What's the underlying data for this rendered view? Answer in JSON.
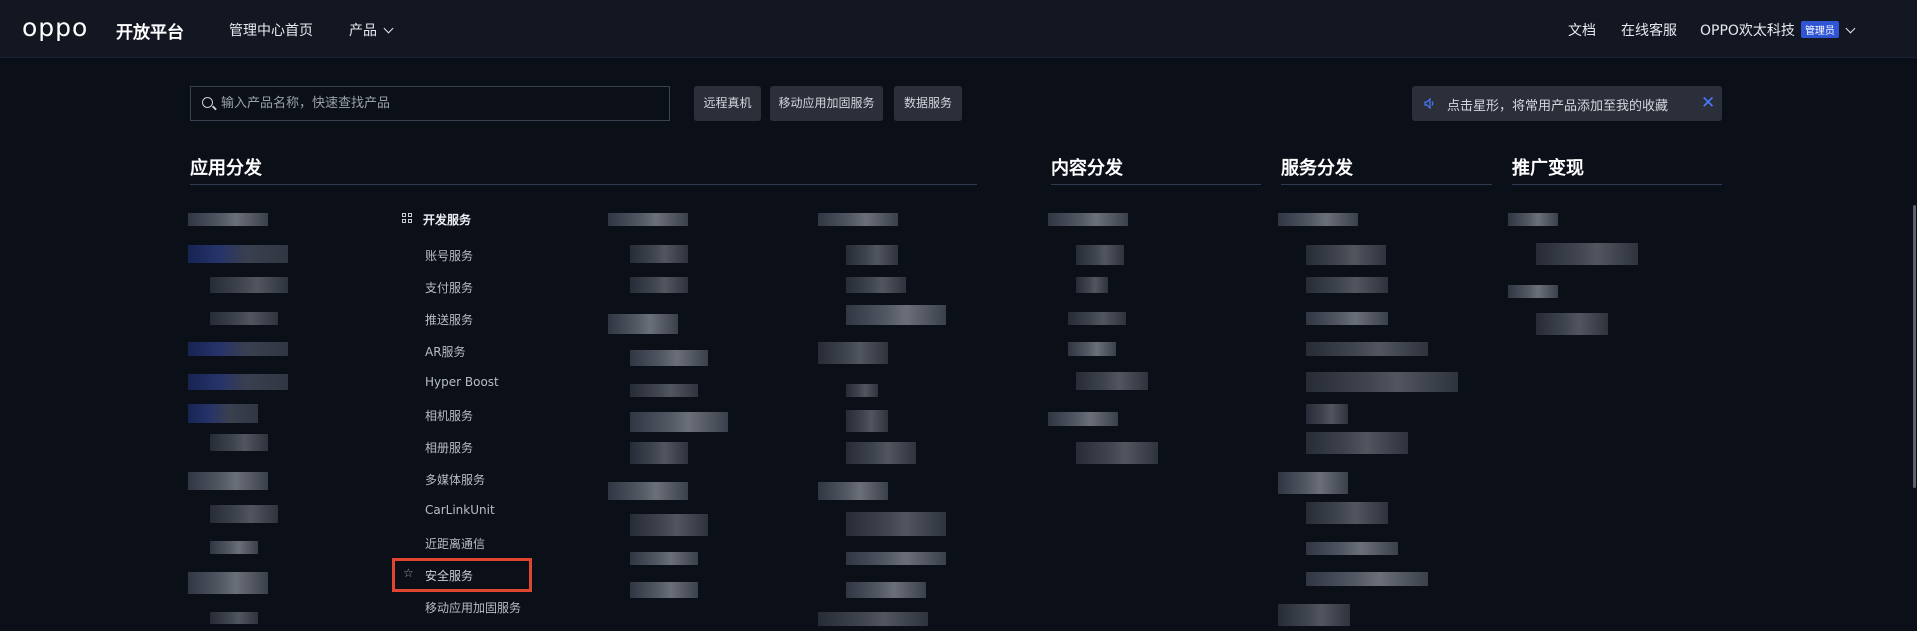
{
  "header": {
    "logo": "oppo",
    "platform": "开放平台",
    "nav_home": "管理中心首页",
    "nav_product": "产品",
    "nav_docs": "文档",
    "nav_support": "在线客服",
    "account": "OPPO欢太科技",
    "admin_badge": "管理员"
  },
  "search": {
    "placeholder": "输入产品名称，快速查找产品"
  },
  "quick_chips": [
    "远程真机",
    "移动应用加固服务",
    "数据服务"
  ],
  "tip": {
    "text": "点击星形，将常用产品添加至我的收藏",
    "close_icon": "close-icon"
  },
  "sections": [
    "应用分发",
    "内容分发",
    "服务分发",
    "推广变现"
  ],
  "dev_services": {
    "heading": "开发服务",
    "items": [
      "账号服务",
      "支付服务",
      "推送服务",
      "AR服务",
      "Hyper Boost",
      "相机服务",
      "相册服务",
      "多媒体服务",
      "CarLinkUnit",
      "近距离通信",
      "安全服务",
      "移动应用加固服务"
    ],
    "highlighted": "安全服务"
  },
  "colors": {
    "background": "#0b0f18",
    "topbar": "#121722",
    "accent": "#2f55d4",
    "highlight_border": "#e0462f"
  }
}
